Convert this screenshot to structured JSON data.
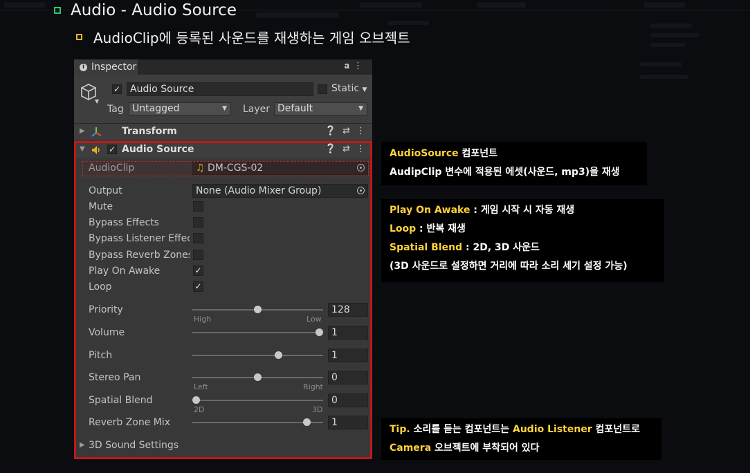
{
  "slide": {
    "title": "Audio - Audio Source",
    "subtitle": "AudioClip에 등록된 사운드를 재생하는 게임 오브젝트"
  },
  "inspector": {
    "tab_label": "Inspector",
    "gameobject": {
      "enabled": true,
      "name": "Audio Source",
      "static_label": "Static",
      "tag_label": "Tag",
      "tag_value": "Untagged",
      "layer_label": "Layer",
      "layer_value": "Default"
    },
    "transform": {
      "title": "Transform"
    },
    "audio_source": {
      "title": "Audio Source",
      "enabled": true,
      "audioclip_label": "AudioClip",
      "audioclip_value": "DM-CGS-02",
      "output_label": "Output",
      "output_value": "None (Audio Mixer Group)",
      "mute_label": "Mute",
      "mute": false,
      "bypass_effects_label": "Bypass Effects",
      "bypass_effects": false,
      "bypass_listener_label": "Bypass Listener Effects",
      "bypass_listener": false,
      "bypass_reverb_label": "Bypass Reverb Zones",
      "bypass_reverb": false,
      "play_on_awake_label": "Play On Awake",
      "play_on_awake": true,
      "loop_label": "Loop",
      "loop": true,
      "priority_label": "Priority",
      "priority_value": "128",
      "priority_level": 0.5,
      "priority_low_hint": "High",
      "priority_high_hint": "Low",
      "volume_label": "Volume",
      "volume_value": "1",
      "volume_level": 1.0,
      "pitch_label": "Pitch",
      "pitch_value": "1",
      "pitch_level": 0.67,
      "stereo_pan_label": "Stereo Pan",
      "stereo_pan_value": "0",
      "stereo_pan_level": 0.5,
      "stereo_left_hint": "Left",
      "stereo_right_hint": "Right",
      "spatial_blend_label": "Spatial Blend",
      "spatial_blend_value": "0",
      "spatial_blend_level": 0.0,
      "spatial_2d_hint": "2D",
      "spatial_3d_hint": "3D",
      "reverb_mix_label": "Reverb Zone Mix",
      "reverb_mix_value": "1",
      "reverb_mix_level": 0.9,
      "sound_settings_label": "3D Sound Settings"
    }
  },
  "callouts": {
    "c1": {
      "h1": "AudioSource",
      "t1": " 컴포넌트",
      "line2": "AudipClip 변수에 적용된 에셋(사운드, mp3)을 재생"
    },
    "c2": {
      "h1": "Play On Awake",
      "t1": " : 게임 시작 시 자동 재생",
      "h2": "Loop",
      "t2": " : 반복 재생",
      "h3": "Spatial Blend",
      "t3": " : 2D, 3D 사운드",
      "line4": "(3D 사운드로 설정하면 거리에 따라 소리 세기 설정 가능)"
    },
    "c3": {
      "h1": "Tip.",
      "t1": " 소리를 듣는 컴포넌트는 ",
      "h2": "Audio Listener",
      "t2": " 컴포넌트로",
      "h3": "Camera",
      "t3": " 오브젝트에 부착되어 있다"
    }
  },
  "colors": {
    "highlight": "#ffd23a",
    "outline": "#c01818",
    "slide_bullet_1": "#2ec46b",
    "slide_bullet_2": "#e4b52c"
  }
}
